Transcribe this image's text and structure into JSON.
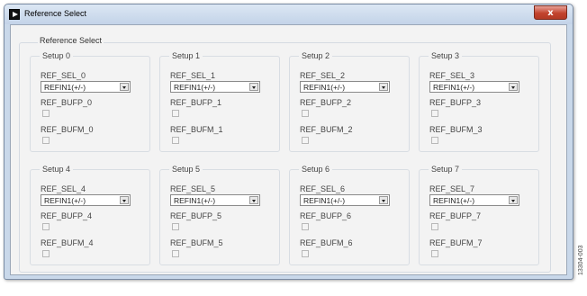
{
  "window": {
    "title": "Reference Select",
    "close_label": "x"
  },
  "group_label": "Reference Select",
  "setups": [
    {
      "title": "Setup 0",
      "sel_label": "REF_SEL_0",
      "sel_value": "REFIN1(+/-)",
      "bufp_label": "REF_BUFP_0",
      "bufp_checked": false,
      "bufm_label": "REF_BUFM_0",
      "bufm_checked": false
    },
    {
      "title": "Setup 1",
      "sel_label": "REF_SEL_1",
      "sel_value": "REFIN1(+/-)",
      "bufp_label": "REF_BUFP_1",
      "bufp_checked": false,
      "bufm_label": "REF_BUFM_1",
      "bufm_checked": false
    },
    {
      "title": "Setup 2",
      "sel_label": "REF_SEL_2",
      "sel_value": "REFIN1(+/-)",
      "bufp_label": "REF_BUFP_2",
      "bufp_checked": false,
      "bufm_label": "REF_BUFM_2",
      "bufm_checked": false
    },
    {
      "title": "Setup 3",
      "sel_label": "REF_SEL_3",
      "sel_value": "REFIN1(+/-)",
      "bufp_label": "REF_BUFP_3",
      "bufp_checked": false,
      "bufm_label": "REF_BUFM_3",
      "bufm_checked": false
    },
    {
      "title": "Setup 4",
      "sel_label": "REF_SEL_4",
      "sel_value": "REFIN1(+/-)",
      "bufp_label": "REF_BUFP_4",
      "bufp_checked": false,
      "bufm_label": "REF_BUFM_4",
      "bufm_checked": false
    },
    {
      "title": "Setup 5",
      "sel_label": "REF_SEL_5",
      "sel_value": "REFIN1(+/-)",
      "bufp_label": "REF_BUFP_5",
      "bufp_checked": false,
      "bufm_label": "REF_BUFM_5",
      "bufm_checked": false
    },
    {
      "title": "Setup 6",
      "sel_label": "REF_SEL_6",
      "sel_value": "REFIN1(+/-)",
      "bufp_label": "REF_BUFP_6",
      "bufp_checked": false,
      "bufm_label": "REF_BUFM_6",
      "bufm_checked": false
    },
    {
      "title": "Setup 7",
      "sel_label": "REF_SEL_7",
      "sel_value": "REFIN1(+/-)",
      "bufp_label": "REF_BUFP_7",
      "bufp_checked": false,
      "bufm_label": "REF_BUFM_7",
      "bufm_checked": false
    }
  ],
  "figure_id": "13304-003",
  "colors": {
    "close_button": "#c2432e",
    "titlebar": "#c9d8ea",
    "client_bg": "#f3f3f3"
  },
  "icons": {
    "app": "app-logo-icon",
    "close": "close-icon",
    "dropdown": "chevron-down-icon"
  }
}
